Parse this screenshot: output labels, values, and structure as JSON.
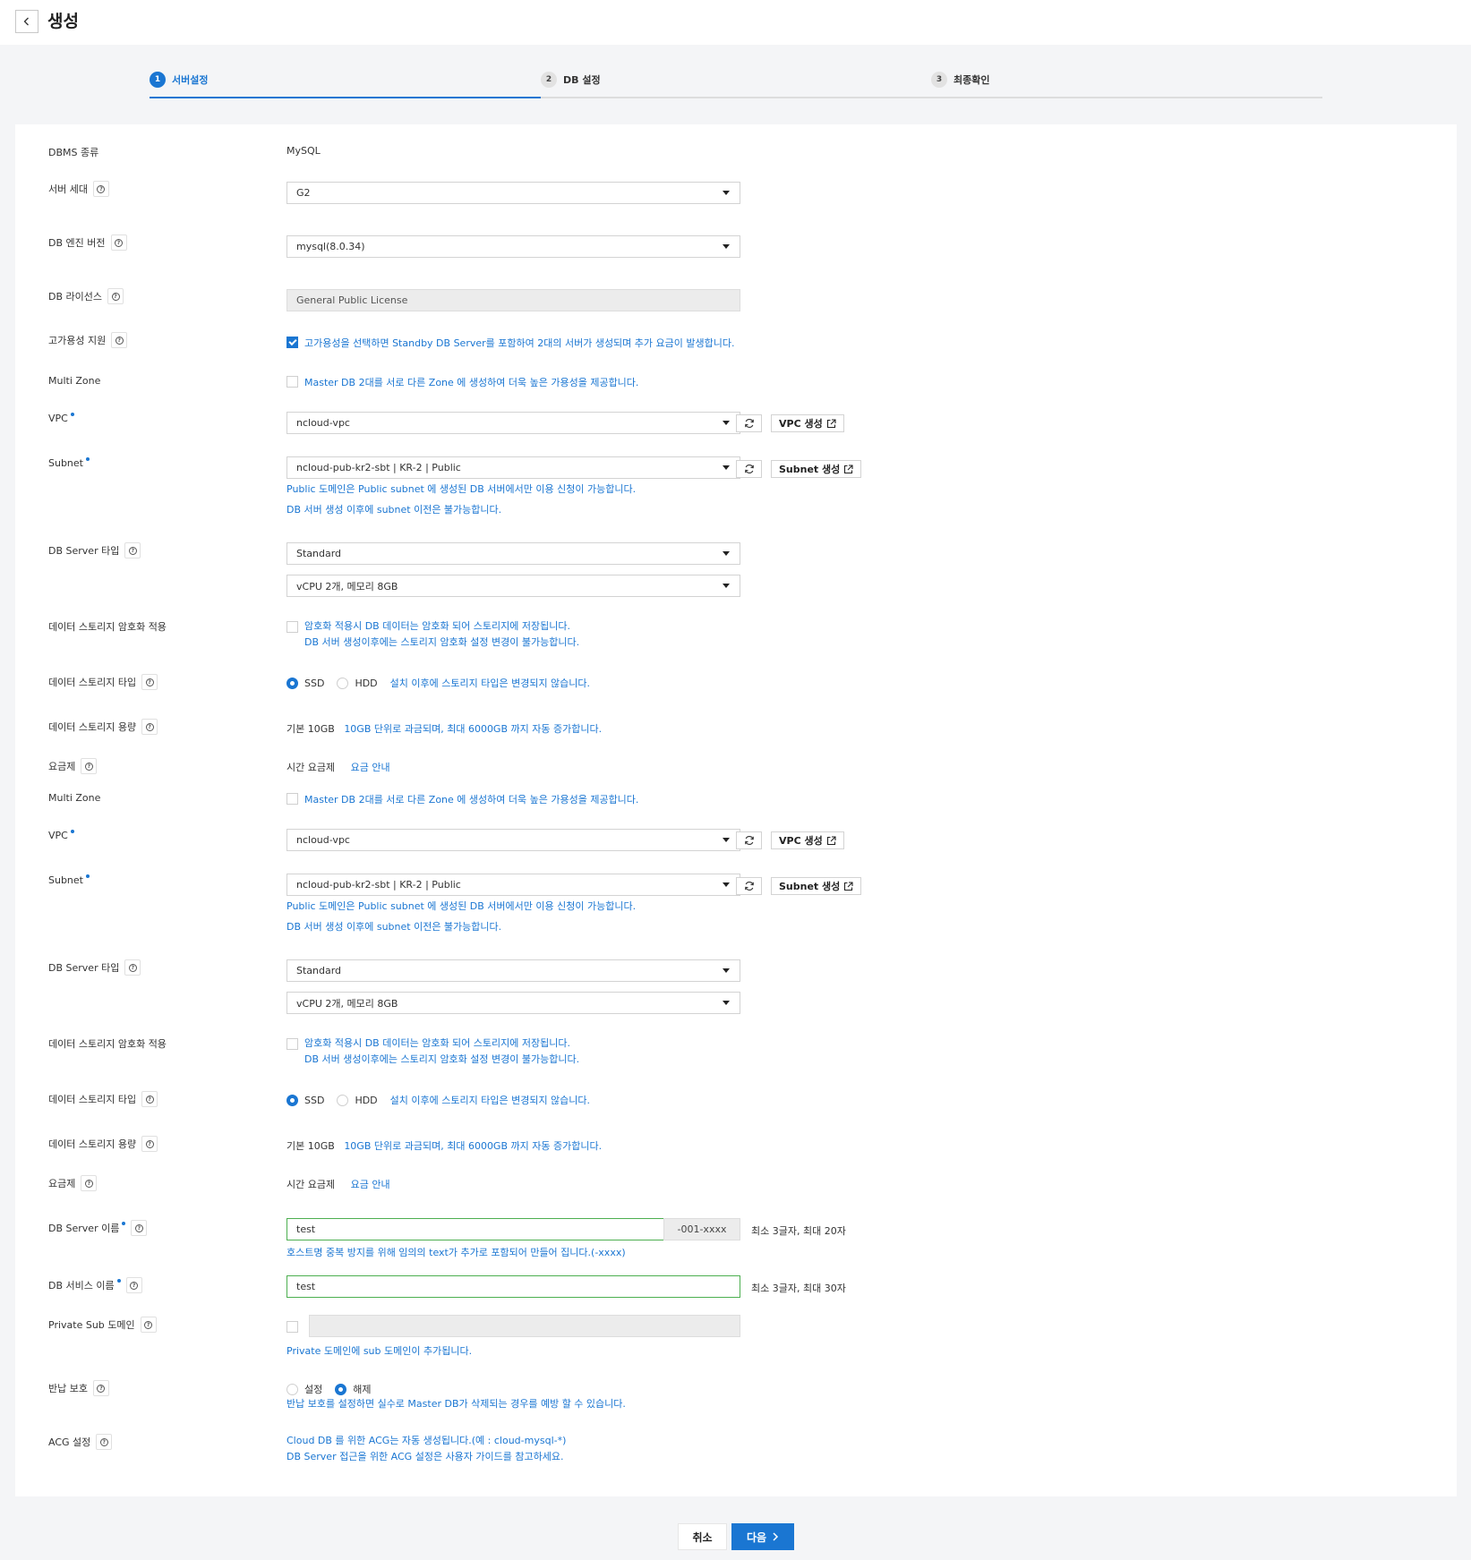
{
  "header": {
    "title": "생성"
  },
  "steps": [
    {
      "num": "1",
      "label": "서버설정"
    },
    {
      "num": "2",
      "label": "DB 설정"
    },
    {
      "num": "3",
      "label": "최종확인"
    }
  ],
  "form": {
    "dbms_type": {
      "label": "DBMS 종류",
      "value": "MySQL"
    },
    "server_gen": {
      "label": "서버 세대",
      "value": "G2"
    },
    "engine_version": {
      "label": "DB 엔진 버전",
      "value": "mysql(8.0.34)"
    },
    "license": {
      "label": "DB 라이선스",
      "value": "General Public License"
    },
    "ha": {
      "label": "고가용성 지원",
      "text": "고가용성을 선택하면 Standby DB Server를 포함하여 2대의 서버가 생성되며 추가 요금이 발생합니다.",
      "checked": true
    },
    "blocks": [
      {
        "multizone": {
          "label": "Multi Zone",
          "text": "Master DB 2대를 서로 다른 Zone 에 생성하여 더욱 높은 가용성을 제공합니다."
        },
        "vpc": {
          "label": "VPC",
          "value": "ncloud-vpc",
          "create": "VPC 생성"
        },
        "subnet": {
          "label": "Subnet",
          "value": "ncloud-pub-kr2-sbt | KR-2 | Public",
          "create": "Subnet 생성",
          "info1": "Public 도메인은 Public subnet 에 생성된 DB 서버에서만 이용 신청이 가능합니다.",
          "info2": "DB 서버 생성 이후에 subnet 이전은 불가능합니다."
        },
        "server_type": {
          "label": "DB Server 타입",
          "value1": "Standard",
          "value2": "vCPU 2개, 메모리 8GB"
        },
        "encryption": {
          "label": "데이터 스토리지 암호화 적용",
          "line1": "암호화 적용시 DB 데이터는 암호화 되어 스토리지에 저장됩니다.",
          "line2": "DB 서버 생성이후에는 스토리지 암호화 설정 변경이 불가능합니다."
        },
        "storage_type": {
          "label": "데이터 스토리지 타입",
          "opt1": "SSD",
          "opt2": "HDD",
          "note": "설치 이후에 스토리지 타입은 변경되지 않습니다."
        },
        "storage_size": {
          "label": "데이터 스토리지 용량",
          "base": "기본 10GB",
          "note": "10GB 단위로 과금되며, 최대 6000GB 까지 자동 증가합니다."
        },
        "pricing": {
          "label": "요금제",
          "value": "시간 요금제",
          "link": "요금 안내"
        }
      },
      {
        "multizone": {
          "label": "Multi Zone",
          "text": "Master DB 2대를 서로 다른 Zone 에 생성하여 더욱 높은 가용성을 제공합니다."
        },
        "vpc": {
          "label": "VPC",
          "value": "ncloud-vpc",
          "create": "VPC 생성"
        },
        "subnet": {
          "label": "Subnet",
          "value": "ncloud-pub-kr2-sbt | KR-2 | Public",
          "create": "Subnet 생성",
          "info1": "Public 도메인은 Public subnet 에 생성된 DB 서버에서만 이용 신청이 가능합니다.",
          "info2": "DB 서버 생성 이후에 subnet 이전은 불가능합니다."
        },
        "server_type": {
          "label": "DB Server 타입",
          "value1": "Standard",
          "value2": "vCPU 2개, 메모리 8GB"
        },
        "encryption": {
          "label": "데이터 스토리지 암호화 적용",
          "line1": "암호화 적용시 DB 데이터는 암호화 되어 스토리지에 저장됩니다.",
          "line2": "DB 서버 생성이후에는 스토리지 암호화 설정 변경이 불가능합니다."
        },
        "storage_type": {
          "label": "데이터 스토리지 타입",
          "opt1": "SSD",
          "opt2": "HDD",
          "note": "설치 이후에 스토리지 타입은 변경되지 않습니다."
        },
        "storage_size": {
          "label": "데이터 스토리지 용량",
          "base": "기본 10GB",
          "note": "10GB 단위로 과금되며, 최대 6000GB 까지 자동 증가합니다."
        },
        "pricing": {
          "label": "요금제",
          "value": "시간 요금제",
          "link": "요금 안내"
        }
      }
    ],
    "server_name": {
      "label": "DB Server 이름",
      "value": "test",
      "suffix": "-001-xxxx",
      "hint": "최소 3글자, 최대 20자",
      "info": "호스트명 중복 방지를 위해 임의의 text가 추가로 포함되어 만들어 집니다.(-xxxx)"
    },
    "service_name": {
      "label": "DB 서비스 이름",
      "value": "test",
      "hint": "최소 3글자, 최대 30자"
    },
    "private_sub": {
      "label": "Private Sub 도메인",
      "info": "Private 도메인에 sub 도메인이 추가됩니다."
    },
    "return_protect": {
      "label": "반납 보호",
      "opt1": "설정",
      "opt2": "해제",
      "info": "반납 보호를 설정하면 실수로 Master DB가 삭제되는 경우를 예방 할 수 있습니다."
    },
    "acg": {
      "label": "ACG 설정",
      "info1": "Cloud DB 를 위한 ACG는 자동 생성됩니다.(예 : cloud-mysql-*)",
      "info2": "DB Server 접근을 위한 ACG 설정은 사용자 가이드를 참고하세요."
    }
  },
  "footer": {
    "cancel": "취소",
    "next": "다음"
  },
  "colors": {
    "accent": "#1a76d2",
    "valid": "#4caf50"
  }
}
